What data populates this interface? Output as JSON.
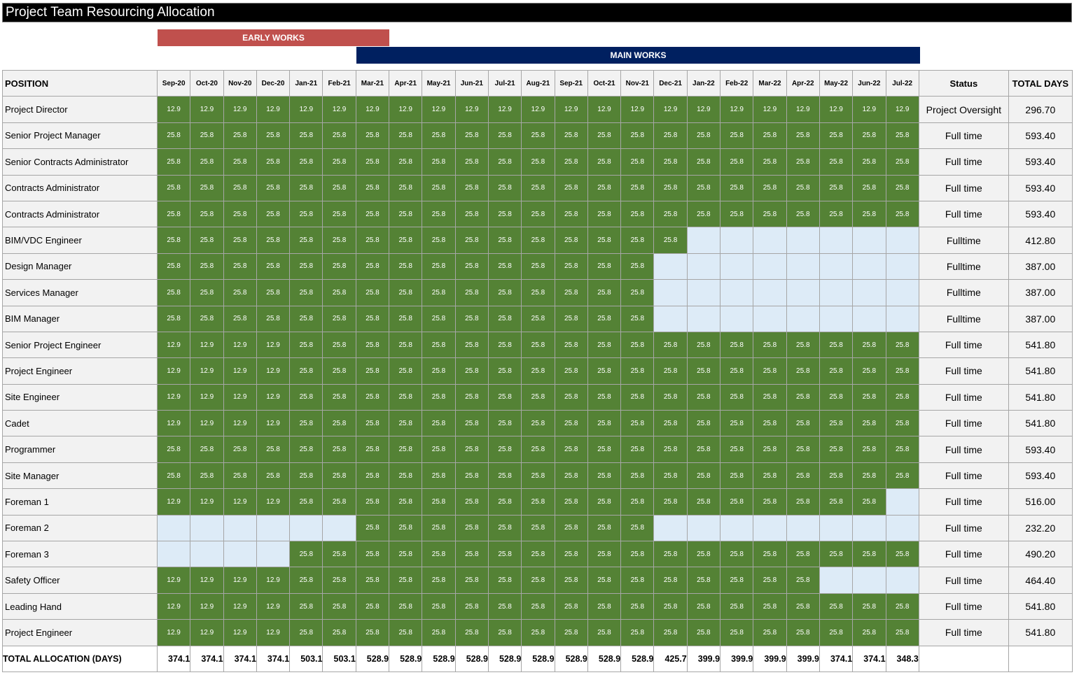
{
  "title": "Project Team Resourcing Allocation",
  "phases": {
    "early": "EARLY WORKS",
    "main": "MAIN WORKS"
  },
  "headers": {
    "position": "POSITION",
    "months": [
      "Sep-20",
      "Oct-20",
      "Nov-20",
      "Dec-20",
      "Jan-21",
      "Feb-21",
      "Mar-21",
      "Apr-21",
      "May-21",
      "Jun-21",
      "Jul-21",
      "Aug-21",
      "Sep-21",
      "Oct-21",
      "Nov-21",
      "Dec-21",
      "Jan-22",
      "Feb-22",
      "Mar-22",
      "Apr-22",
      "May-22",
      "Jun-22",
      "Jul-22"
    ],
    "status": "Status",
    "total": "TOTAL DAYS"
  },
  "colors": {
    "filled": "#548235",
    "empty": "#ddebf7",
    "early": "#c0504d",
    "main": "#002060"
  },
  "rows": [
    {
      "position": "Project Director",
      "values": [
        "12.9",
        "12.9",
        "12.9",
        "12.9",
        "12.9",
        "12.9",
        "12.9",
        "12.9",
        "12.9",
        "12.9",
        "12.9",
        "12.9",
        "12.9",
        "12.9",
        "12.9",
        "12.9",
        "12.9",
        "12.9",
        "12.9",
        "12.9",
        "12.9",
        "12.9",
        "12.9"
      ],
      "status": "Project Oversight",
      "total": "296.70"
    },
    {
      "position": "Senior Project Manager",
      "values": [
        "25.8",
        "25.8",
        "25.8",
        "25.8",
        "25.8",
        "25.8",
        "25.8",
        "25.8",
        "25.8",
        "25.8",
        "25.8",
        "25.8",
        "25.8",
        "25.8",
        "25.8",
        "25.8",
        "25.8",
        "25.8",
        "25.8",
        "25.8",
        "25.8",
        "25.8",
        "25.8"
      ],
      "status": "Full time",
      "total": "593.40"
    },
    {
      "position": "Senior Contracts Administrator",
      "values": [
        "25.8",
        "25.8",
        "25.8",
        "25.8",
        "25.8",
        "25.8",
        "25.8",
        "25.8",
        "25.8",
        "25.8",
        "25.8",
        "25.8",
        "25.8",
        "25.8",
        "25.8",
        "25.8",
        "25.8",
        "25.8",
        "25.8",
        "25.8",
        "25.8",
        "25.8",
        "25.8"
      ],
      "status": "Full time",
      "total": "593.40"
    },
    {
      "position": "Contracts Administrator",
      "values": [
        "25.8",
        "25.8",
        "25.8",
        "25.8",
        "25.8",
        "25.8",
        "25.8",
        "25.8",
        "25.8",
        "25.8",
        "25.8",
        "25.8",
        "25.8",
        "25.8",
        "25.8",
        "25.8",
        "25.8",
        "25.8",
        "25.8",
        "25.8",
        "25.8",
        "25.8",
        "25.8"
      ],
      "status": "Full time",
      "total": "593.40"
    },
    {
      "position": "Contracts Administrator",
      "values": [
        "25.8",
        "25.8",
        "25.8",
        "25.8",
        "25.8",
        "25.8",
        "25.8",
        "25.8",
        "25.8",
        "25.8",
        "25.8",
        "25.8",
        "25.8",
        "25.8",
        "25.8",
        "25.8",
        "25.8",
        "25.8",
        "25.8",
        "25.8",
        "25.8",
        "25.8",
        "25.8"
      ],
      "status": "Full time",
      "total": "593.40"
    },
    {
      "position": "BIM/VDC Engineer",
      "values": [
        "25.8",
        "25.8",
        "25.8",
        "25.8",
        "25.8",
        "25.8",
        "25.8",
        "25.8",
        "25.8",
        "25.8",
        "25.8",
        "25.8",
        "25.8",
        "25.8",
        "25.8",
        "25.8",
        "",
        "",
        "",
        "",
        "",
        "",
        ""
      ],
      "status": "Fulltime",
      "total": "412.80"
    },
    {
      "position": "Design Manager",
      "values": [
        "25.8",
        "25.8",
        "25.8",
        "25.8",
        "25.8",
        "25.8",
        "25.8",
        "25.8",
        "25.8",
        "25.8",
        "25.8",
        "25.8",
        "25.8",
        "25.8",
        "25.8",
        "",
        "",
        "",
        "",
        "",
        "",
        "",
        ""
      ],
      "status": "Fulltime",
      "total": "387.00"
    },
    {
      "position": "Services Manager",
      "values": [
        "25.8",
        "25.8",
        "25.8",
        "25.8",
        "25.8",
        "25.8",
        "25.8",
        "25.8",
        "25.8",
        "25.8",
        "25.8",
        "25.8",
        "25.8",
        "25.8",
        "25.8",
        "",
        "",
        "",
        "",
        "",
        "",
        "",
        ""
      ],
      "status": "Fulltime",
      "total": "387.00"
    },
    {
      "position": "BIM Manager",
      "values": [
        "25.8",
        "25.8",
        "25.8",
        "25.8",
        "25.8",
        "25.8",
        "25.8",
        "25.8",
        "25.8",
        "25.8",
        "25.8",
        "25.8",
        "25.8",
        "25.8",
        "25.8",
        "",
        "",
        "",
        "",
        "",
        "",
        "",
        ""
      ],
      "status": "Fulltime",
      "total": "387.00"
    },
    {
      "position": "Senior Project Engineer",
      "values": [
        "12.9",
        "12.9",
        "12.9",
        "12.9",
        "25.8",
        "25.8",
        "25.8",
        "25.8",
        "25.8",
        "25.8",
        "25.8",
        "25.8",
        "25.8",
        "25.8",
        "25.8",
        "25.8",
        "25.8",
        "25.8",
        "25.8",
        "25.8",
        "25.8",
        "25.8",
        "25.8"
      ],
      "status": "Full time",
      "total": "541.80"
    },
    {
      "position": "Project Engineer",
      "values": [
        "12.9",
        "12.9",
        "12.9",
        "12.9",
        "25.8",
        "25.8",
        "25.8",
        "25.8",
        "25.8",
        "25.8",
        "25.8",
        "25.8",
        "25.8",
        "25.8",
        "25.8",
        "25.8",
        "25.8",
        "25.8",
        "25.8",
        "25.8",
        "25.8",
        "25.8",
        "25.8"
      ],
      "status": "Full time",
      "total": "541.80"
    },
    {
      "position": "Site Engineer",
      "values": [
        "12.9",
        "12.9",
        "12.9",
        "12.9",
        "25.8",
        "25.8",
        "25.8",
        "25.8",
        "25.8",
        "25.8",
        "25.8",
        "25.8",
        "25.8",
        "25.8",
        "25.8",
        "25.8",
        "25.8",
        "25.8",
        "25.8",
        "25.8",
        "25.8",
        "25.8",
        "25.8"
      ],
      "status": "Full time",
      "total": "541.80"
    },
    {
      "position": "Cadet",
      "values": [
        "12.9",
        "12.9",
        "12.9",
        "12.9",
        "25.8",
        "25.8",
        "25.8",
        "25.8",
        "25.8",
        "25.8",
        "25.8",
        "25.8",
        "25.8",
        "25.8",
        "25.8",
        "25.8",
        "25.8",
        "25.8",
        "25.8",
        "25.8",
        "25.8",
        "25.8",
        "25.8"
      ],
      "status": "Full time",
      "total": "541.80"
    },
    {
      "position": "Programmer",
      "values": [
        "25.8",
        "25.8",
        "25.8",
        "25.8",
        "25.8",
        "25.8",
        "25.8",
        "25.8",
        "25.8",
        "25.8",
        "25.8",
        "25.8",
        "25.8",
        "25.8",
        "25.8",
        "25.8",
        "25.8",
        "25.8",
        "25.8",
        "25.8",
        "25.8",
        "25.8",
        "25.8"
      ],
      "status": "Full time",
      "total": "593.40"
    },
    {
      "position": "Site Manager",
      "values": [
        "25.8",
        "25.8",
        "25.8",
        "25.8",
        "25.8",
        "25.8",
        "25.8",
        "25.8",
        "25.8",
        "25.8",
        "25.8",
        "25.8",
        "25.8",
        "25.8",
        "25.8",
        "25.8",
        "25.8",
        "25.8",
        "25.8",
        "25.8",
        "25.8",
        "25.8",
        "25.8"
      ],
      "status": "Full time",
      "total": "593.40"
    },
    {
      "position": "Foreman 1",
      "values": [
        "12.9",
        "12.9",
        "12.9",
        "12.9",
        "25.8",
        "25.8",
        "25.8",
        "25.8",
        "25.8",
        "25.8",
        "25.8",
        "25.8",
        "25.8",
        "25.8",
        "25.8",
        "25.8",
        "25.8",
        "25.8",
        "25.8",
        "25.8",
        "25.8",
        "25.8",
        ""
      ],
      "status": "Full time",
      "total": "516.00"
    },
    {
      "position": "Foreman 2",
      "values": [
        "",
        "",
        "",
        "",
        "",
        "",
        "25.8",
        "25.8",
        "25.8",
        "25.8",
        "25.8",
        "25.8",
        "25.8",
        "25.8",
        "25.8",
        "",
        "",
        "",
        "",
        "",
        "",
        "",
        ""
      ],
      "status": "Full time",
      "total": "232.20"
    },
    {
      "position": "Foreman 3",
      "values": [
        "",
        "",
        "",
        "",
        "25.8",
        "25.8",
        "25.8",
        "25.8",
        "25.8",
        "25.8",
        "25.8",
        "25.8",
        "25.8",
        "25.8",
        "25.8",
        "25.8",
        "25.8",
        "25.8",
        "25.8",
        "25.8",
        "25.8",
        "25.8",
        "25.8"
      ],
      "status": "Full time",
      "total": "490.20"
    },
    {
      "position": "Safety Officer",
      "values": [
        "12.9",
        "12.9",
        "12.9",
        "12.9",
        "25.8",
        "25.8",
        "25.8",
        "25.8",
        "25.8",
        "25.8",
        "25.8",
        "25.8",
        "25.8",
        "25.8",
        "25.8",
        "25.8",
        "25.8",
        "25.8",
        "25.8",
        "25.8",
        "",
        "",
        ""
      ],
      "status": "Full time",
      "total": "464.40"
    },
    {
      "position": "Leading Hand",
      "values": [
        "12.9",
        "12.9",
        "12.9",
        "12.9",
        "25.8",
        "25.8",
        "25.8",
        "25.8",
        "25.8",
        "25.8",
        "25.8",
        "25.8",
        "25.8",
        "25.8",
        "25.8",
        "25.8",
        "25.8",
        "25.8",
        "25.8",
        "25.8",
        "25.8",
        "25.8",
        "25.8"
      ],
      "status": "Full time",
      "total": "541.80"
    },
    {
      "position": "Project Engineer",
      "values": [
        "12.9",
        "12.9",
        "12.9",
        "12.9",
        "25.8",
        "25.8",
        "25.8",
        "25.8",
        "25.8",
        "25.8",
        "25.8",
        "25.8",
        "25.8",
        "25.8",
        "25.8",
        "25.8",
        "25.8",
        "25.8",
        "25.8",
        "25.8",
        "25.8",
        "25.8",
        "25.8"
      ],
      "status": "Full time",
      "total": "541.80"
    }
  ],
  "summary": {
    "label": "TOTAL ALLOCATION (DAYS)",
    "values": [
      "374.1",
      "374.1",
      "374.1",
      "374.1",
      "503.1",
      "503.1",
      "528.9",
      "528.9",
      "528.9",
      "528.9",
      "528.9",
      "528.9",
      "528.9",
      "528.9",
      "528.9",
      "425.7",
      "399.9",
      "399.9",
      "399.9",
      "399.9",
      "374.1",
      "374.1",
      "348.3"
    ]
  }
}
